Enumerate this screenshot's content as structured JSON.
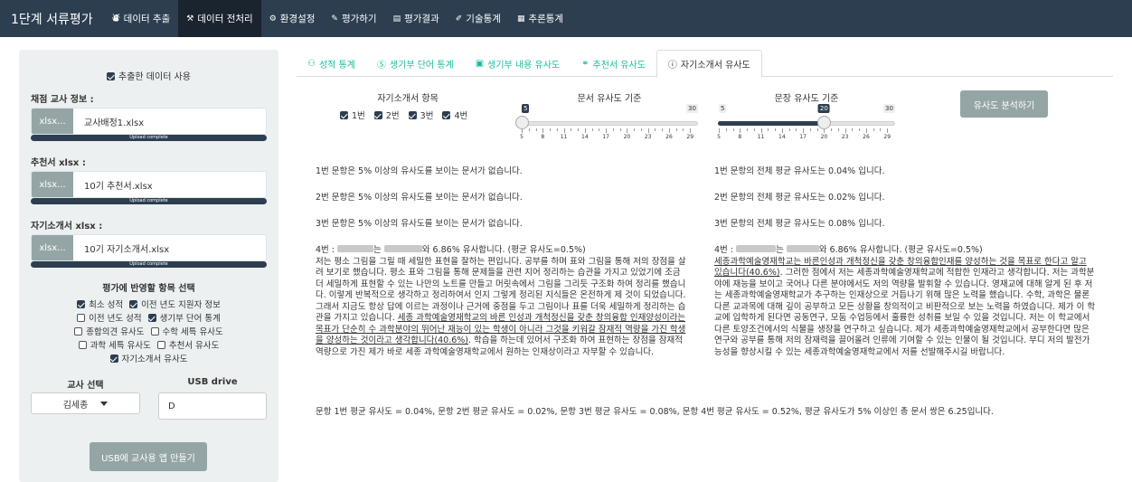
{
  "navbar": {
    "brand": "1단계 서류평가",
    "items": [
      {
        "label": "데이터 추출",
        "icon": "database-icon",
        "active": false
      },
      {
        "label": "데이터 전처리",
        "icon": "tools-icon",
        "active": true
      },
      {
        "label": "환경설정",
        "icon": "cogs-icon",
        "active": false
      },
      {
        "label": "평가하기",
        "icon": "edit-icon",
        "active": false
      },
      {
        "label": "평가결과",
        "icon": "file-icon",
        "active": false
      },
      {
        "label": "기술통계",
        "icon": "pencil-icon",
        "active": false
      },
      {
        "label": "추론통계",
        "icon": "chart-icon",
        "active": false
      }
    ]
  },
  "sidebar": {
    "use_extracted": "추출한 데이터 사용",
    "teacher_label": "채점 교사 정보 :",
    "teacher_file": "교사배정1.xlsx",
    "recommend_label": "추천서 xlsx :",
    "recommend_file": "10기 추천서.xlsx",
    "essay_label": "자기소개서 xlsx :",
    "essay_file": "10기 자기소개서.xlsx",
    "browse_label": "xlsx...",
    "upload_complete": "Upload complete",
    "criteria_title": "평가에 반영할 항목 선택",
    "criteria": [
      {
        "label": "최소 성적",
        "checked": true
      },
      {
        "label": "이전 년도 지원자 정보",
        "checked": true
      },
      {
        "label": "이전 년도 성적",
        "checked": false
      },
      {
        "label": "생기부 단어 통계",
        "checked": true
      },
      {
        "label": "종합의견 유사도",
        "checked": false
      },
      {
        "label": "수학 세특 유사도",
        "checked": false
      },
      {
        "label": "과학 세특 유사도",
        "checked": false
      },
      {
        "label": "추천서 유사도",
        "checked": false
      },
      {
        "label": "자기소개서 유사도",
        "checked": true
      }
    ],
    "teacher_select_label": "교사 선택",
    "teacher_selected": "김세종",
    "usb_label": "USB drive",
    "usb_value": "D",
    "make_app_button": "USB에 교사용 앱 만들기"
  },
  "tabs": [
    {
      "label": "성적 통계",
      "icon": "users-icon",
      "active": false
    },
    {
      "label": "생기부 단어 통계",
      "icon": "wordpress-icon",
      "active": false
    },
    {
      "label": "생기부 내용 유사도",
      "icon": "save-icon",
      "active": false
    },
    {
      "label": "추천서 유사도",
      "icon": "glasses-icon",
      "active": false
    },
    {
      "label": "자기소개서 유사도",
      "icon": "info-circle-icon",
      "active": true
    }
  ],
  "controls": {
    "items_title": "자기소개서 항목",
    "items": [
      "1번",
      "2번",
      "3번",
      "4번"
    ],
    "doc_sim_title": "문서 유사도 기준",
    "doc_sim": {
      "min": 5,
      "max": 30,
      "value": 5
    },
    "sent_sim_title": "문장 유사도 기준",
    "sent_sim": {
      "min": 5,
      "max": 30,
      "value": 20
    },
    "tick_labels": [
      "5",
      "8",
      "11",
      "14",
      "17",
      "20",
      "23",
      "26",
      "29"
    ],
    "analyze_button": "유사도 분석하기"
  },
  "results": {
    "left": [
      "1번 문항은 5% 이상의 유사도를 보이는 문서가 없습니다.",
      "2번 문항은 5% 이상의 유사도를 보이는 문서가 없습니다.",
      "3번 문항은 5% 이상의 유사도를 보이는 문서가 없습니다."
    ],
    "right": [
      "1번 문항의 전체 평균 유사도는 0.04% 입니다.",
      "2번 문항의 전체 평균 유사도는 0.02% 입니다.",
      "3번 문항의 전체 평균 유사도는 0.08% 입니다."
    ],
    "q4_header_prefix": "4번 : ",
    "q4_header_mid1": "는 ",
    "q4_header_mid2": "와 6.86% 유사합니다. (평균 유사도=0.5%)",
    "left_essay_a": "저는 평소 그림을 그릴 때 세밀한 표현을 잘하는 편입니다. 공부를 하며 표와 그림을 통해 저의 장점을 살려 보기로 했습니다. 평소 표와 그림을 통해 문제들을 관련 지어 정리하는 습관을 가지고 있었기에 조금 더 세밀하게 표현할 수 있는 나만의 노트를 만들고 머릿속에서 그림을 그리듯 구조화 하여 정리를 했습니다. 이렇게 반복적으로 생각하고 정리하여서 인지 그렇게 정리된 지식들은 온전하게 제 것이 되었습니다. 그래서 지금도 항상 답에 이르는 과정이나 근거에 중점을 두고 그림이나 표를 더욱 세밀하게 정리하는 습관을 가지고 있습니다. ",
    "left_essay_u": "세종 과학예술영재학교의 바른 인성과 개척정신을 갖춘 창의융합 인재양성이라는 목표가 단순히 수 과학분야의 뛰어난 재능이 있는 학생이 아니라 그것을 키워갈 잠재적 역량을 가진 학생을 양성하는 것이라고 생각합니다(40.6%)",
    "left_essay_b": ". 학습을 하는데 있어서 구조화 하여 표현하는 장점을 잠재적 역량으로 가진 제가 바로 세종 과학예술영재학교에서 원하는 인재상이라고 자부할 수 있습니다.",
    "right_essay_u": "세종과학예술영재학교는 바른인성과 개척정신을 갖춘 창의융합인재를 양성하는 것을 목표로 한다고 알고 있습니다(40.6%)",
    "right_essay_b": ". 그러한 점에서 저는 세종과학예술영재학교에 적합한 인재라고 생각합니다. 저는 과학분야에 재능을 보이고 국어나 다른 분야에서도 저의 역량을 발휘할 수 있습니다. 영재교에 대해 알게 된 후 저는 세종과학예술영재학교가 추구하는 인재상으로 거듭나기 위해 많은 노력을 했습니다. 수학, 과학은 물론 다른 교과목에 대해 깊이 공부하고 모든 상황을 창의적이고 비판적으로 보는 노력을 하였습니다. 제가 이 학교에 입학하게 된다면 공동연구, 모둠 수업등에서 훌륭한 성취를 보일 수 있을 것입니다. 저는 이 학교에서 다른 토양조건에서의 식물을 생장을 연구하고 싶습니다. 제가 세종과학예술영재학교에서 공부한다면 많은 연구와 공부를 통해 저의 잠재력을 끌어올려 인류에 기여할 수 있는 인물이 될 것입니다. 부디 저의 발전가능성을 향상시킬 수 있는 세종과학예술영재학교에서 저를 선발해주시길 바랍니다.",
    "summary": "문항 1번 평균 유사도 = 0.04%, 문항 2번 평균 유사도 = 0.02%, 문항 3번 평균 유사도 = 0.08%, 문항 4번 평균 유사도 = 0.52%, 평균 유사도가 5% 이상인 총 문서 쌍은 6.25입니다."
  }
}
